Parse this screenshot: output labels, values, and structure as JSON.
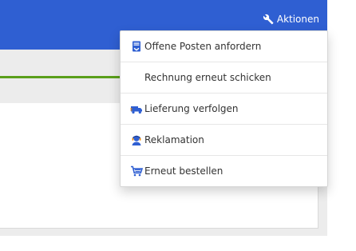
{
  "header": {
    "actions_label": "Aktionen",
    "actions_icon": "wrench-icon",
    "brand_color": "#2f5fd2"
  },
  "page": {
    "progress_color": "#5a9f1b"
  },
  "menu": {
    "items": [
      {
        "label": "Offene Posten anfordern",
        "icon": "document-request-icon"
      },
      {
        "label": "Rechnung erneut schicken",
        "icon": ""
      },
      {
        "label": "Lieferung verfolgen",
        "icon": "delivery-truck-icon"
      },
      {
        "label": "Reklamation",
        "icon": "support-agent-icon"
      },
      {
        "label": "Erneut bestellen",
        "icon": "shopping-cart-icon"
      }
    ]
  }
}
